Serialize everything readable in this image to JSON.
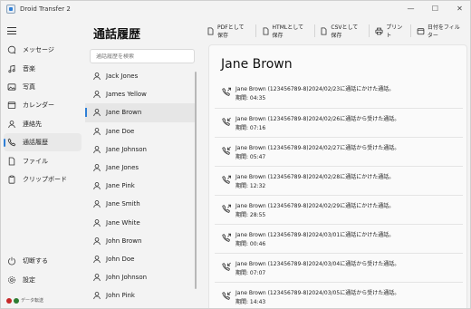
{
  "app": {
    "title": "Droid Transfer 2"
  },
  "window_controls": {
    "minimize": "—",
    "maximize": "☐",
    "close": "✕"
  },
  "sidebar": {
    "items": [
      {
        "label": "メッセージ",
        "icon": "message-icon"
      },
      {
        "label": "音楽",
        "icon": "music-icon"
      },
      {
        "label": "写真",
        "icon": "photo-icon"
      },
      {
        "label": "カレンダー",
        "icon": "calendar-icon"
      },
      {
        "label": "連絡先",
        "icon": "contacts-icon"
      },
      {
        "label": "通話履歴",
        "icon": "call-history-icon",
        "active": true
      },
      {
        "label": "ファイル",
        "icon": "file-icon"
      },
      {
        "label": "クリップボード",
        "icon": "clipboard-icon"
      }
    ],
    "bottom": [
      {
        "label": "切断する",
        "icon": "disconnect-icon"
      },
      {
        "label": "設定",
        "icon": "settings-icon"
      }
    ],
    "status": {
      "label": "データ転送",
      "dot_colors": [
        "#c62828",
        "#2e7d32"
      ]
    }
  },
  "header": {
    "title": "通話履歴",
    "actions": {
      "pdf": "PDFとして保存",
      "html": "HTMLとして保存",
      "csv": "CSVとして保存",
      "print": "プリント",
      "filter": "日付をフィルター"
    }
  },
  "search": {
    "placeholder": "通話履歴を検索"
  },
  "contacts": [
    "Jack Jones",
    "James Yellow",
    "Jane Brown",
    "Jane Doe",
    "Jane Johnson",
    "Jane Jones",
    "Jane Pink",
    "Jane Smith",
    "Jane White",
    "John Brown",
    "John Doe",
    "John Johnson",
    "John Pink"
  ],
  "selected_contact": "Jane Brown",
  "detail": {
    "name": "Jane Brown",
    "calls": [
      {
        "direction": "outgoing",
        "line": "Jane Brown (123456789-8)2024/02/23に通話にかけた通話。",
        "duration": "期間: 04:35"
      },
      {
        "direction": "incoming",
        "line": "Jane Brown (123456789-8)2024/02/26に通話から受けた通話。",
        "duration": "期間: 07:16"
      },
      {
        "direction": "incoming",
        "line": "Jane Brown (123456789-8)2024/02/27に通話から受けた通話。",
        "duration": "期間: 05:47"
      },
      {
        "direction": "outgoing",
        "line": "Jane Brown (123456789-8)2024/02/28に通話にかけた通話。",
        "duration": "期間: 12:32"
      },
      {
        "direction": "outgoing",
        "line": "Jane Brown (123456789-8)2024/02/29に通話にかけた通話。",
        "duration": "期間: 28:55"
      },
      {
        "direction": "outgoing",
        "line": "Jane Brown (123456789-8)2024/03/01に通話にかけた通話。",
        "duration": "期間: 00:46"
      },
      {
        "direction": "incoming",
        "line": "Jane Brown (123456789-8)2024/03/04に通話から受けた通話。",
        "duration": "期間: 07:07"
      },
      {
        "direction": "incoming",
        "line": "Jane Brown (123456789-8)2024/03/05に通話から受けた通話。",
        "duration": "期間: 14:43"
      }
    ]
  }
}
